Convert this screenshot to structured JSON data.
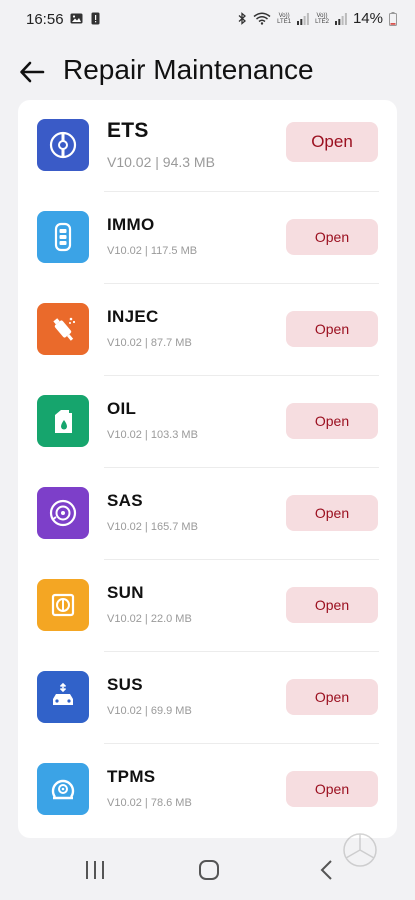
{
  "status_bar": {
    "time": "16:56",
    "battery": "14%",
    "sim1_label_top": "Vo))",
    "sim1_label_bottom": "LTE1",
    "sim2_label_top": "Vo))",
    "sim2_label_bottom": "LTE2"
  },
  "header": {
    "title": "Repair Maintenance",
    "back_icon": "arrow-left-icon"
  },
  "colors": {
    "accent_button_bg": "#f6dde0",
    "accent_button_text": "#9b1020"
  },
  "apps": [
    {
      "name": "ETS",
      "version": "V10.02 | 94.3 MB",
      "button": "Open",
      "icon": "ets-icon",
      "color": "#3a5bc7"
    },
    {
      "name": "IMMO",
      "version": "V10.02 | 117.5 MB",
      "button": "Open",
      "icon": "immo-icon",
      "color": "#3ba3e6"
    },
    {
      "name": "INJEC",
      "version": "V10.02 | 87.7 MB",
      "button": "Open",
      "icon": "injec-icon",
      "color": "#ea6a2b"
    },
    {
      "name": "OIL",
      "version": "V10.02 | 103.3 MB",
      "button": "Open",
      "icon": "oil-icon",
      "color": "#16a56d"
    },
    {
      "name": "SAS",
      "version": "V10.02 | 165.7 MB",
      "button": "Open",
      "icon": "sas-icon",
      "color": "#7d3fc9"
    },
    {
      "name": "SUN",
      "version": "V10.02 | 22.0 MB",
      "button": "Open",
      "icon": "sun-icon",
      "color": "#f4a623"
    },
    {
      "name": "SUS",
      "version": "V10.02 | 69.9 MB",
      "button": "Open",
      "icon": "sus-icon",
      "color": "#3162c9"
    },
    {
      "name": "TPMS",
      "version": "V10.02 | 78.6 MB",
      "button": "Open",
      "icon": "tpms-icon",
      "color": "#3ba3e6"
    }
  ],
  "nav_bar": {
    "recents_icon": "recents-icon",
    "home_icon": "home-icon",
    "back_icon": "nav-back-icon"
  }
}
